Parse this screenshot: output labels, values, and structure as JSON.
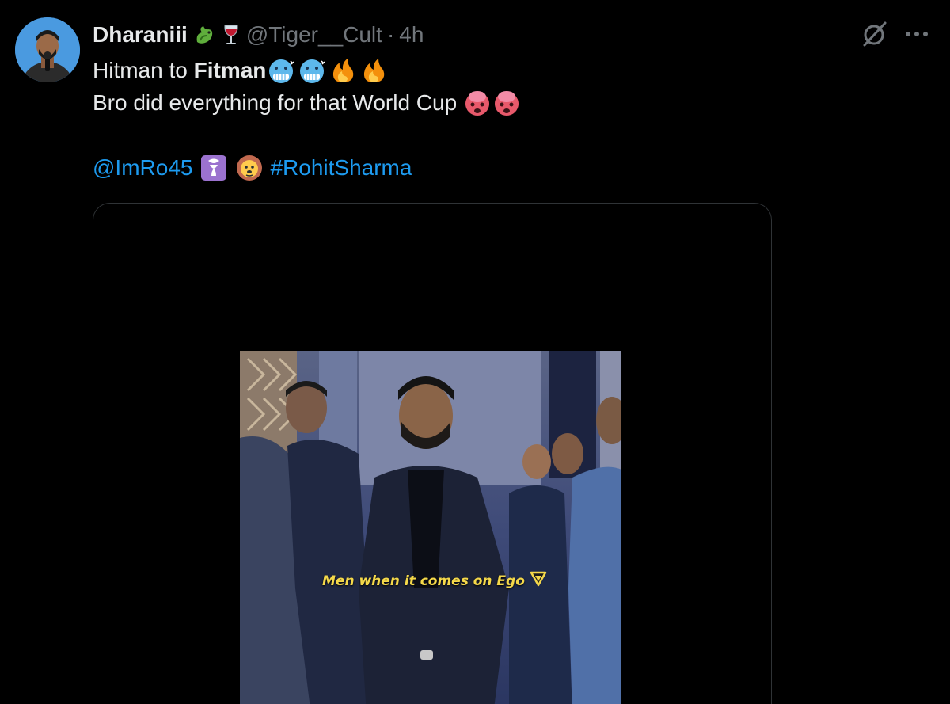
{
  "tweet": {
    "author": {
      "display_name": "Dharaniii",
      "name_emojis": [
        "dragon-icon",
        "wine-glass-icon"
      ],
      "handle": "@Tiger__Cult",
      "separator": "·",
      "time": "4h"
    },
    "actions": {
      "grok_icon": "slash-circle-icon",
      "more_label": "···"
    },
    "text": {
      "line1_prefix": "Hitman to ",
      "line1_bold": "Fitman",
      "line1_emojis": [
        "cold-face-icon",
        "cold-face-icon",
        "fire-icon",
        "fire-icon"
      ],
      "line2": "Bro did everything for that World Cup",
      "line2_emojis": [
        "exploding-head-icon",
        "exploding-head-icon"
      ],
      "mention": "@ImRo45",
      "mention_emojis": [
        "goat-sign-icon",
        "lion-icon"
      ],
      "hashtag": "#RohitSharma"
    },
    "media": {
      "caption": "Men when it comes on Ego",
      "caption_icon": "down-triangle-icon"
    }
  },
  "colors": {
    "background": "#000000",
    "text": "#e7e9ea",
    "muted": "#71767b",
    "link": "#1d9bf0",
    "border": "#2f3336",
    "caption": "#f5d94a"
  }
}
